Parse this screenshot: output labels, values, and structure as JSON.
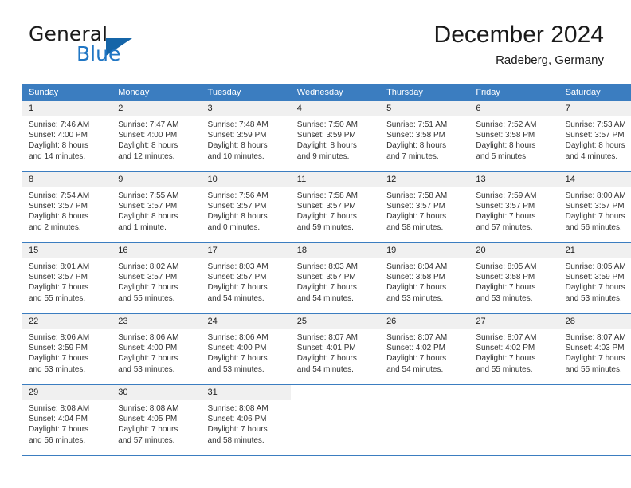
{
  "brand": {
    "name_top": "General",
    "name_bottom": "Blue",
    "accent_color": "#2076c4",
    "triangle_color": "#1565a8"
  },
  "header": {
    "title": "December 2024",
    "subtitle": "Radeberg, Germany"
  },
  "theme": {
    "header_blue": "#3b7dc0",
    "daynum_bg": "#f0f0f0",
    "text": "#222222"
  },
  "calendar": {
    "weekday_headers": [
      "Sunday",
      "Monday",
      "Tuesday",
      "Wednesday",
      "Thursday",
      "Friday",
      "Saturday"
    ],
    "weeks": [
      [
        {
          "day": "1",
          "sunrise": "Sunrise: 7:46 AM",
          "sunset": "Sunset: 4:00 PM",
          "daylight1": "Daylight: 8 hours",
          "daylight2": "and 14 minutes."
        },
        {
          "day": "2",
          "sunrise": "Sunrise: 7:47 AM",
          "sunset": "Sunset: 4:00 PM",
          "daylight1": "Daylight: 8 hours",
          "daylight2": "and 12 minutes."
        },
        {
          "day": "3",
          "sunrise": "Sunrise: 7:48 AM",
          "sunset": "Sunset: 3:59 PM",
          "daylight1": "Daylight: 8 hours",
          "daylight2": "and 10 minutes."
        },
        {
          "day": "4",
          "sunrise": "Sunrise: 7:50 AM",
          "sunset": "Sunset: 3:59 PM",
          "daylight1": "Daylight: 8 hours",
          "daylight2": "and 9 minutes."
        },
        {
          "day": "5",
          "sunrise": "Sunrise: 7:51 AM",
          "sunset": "Sunset: 3:58 PM",
          "daylight1": "Daylight: 8 hours",
          "daylight2": "and 7 minutes."
        },
        {
          "day": "6",
          "sunrise": "Sunrise: 7:52 AM",
          "sunset": "Sunset: 3:58 PM",
          "daylight1": "Daylight: 8 hours",
          "daylight2": "and 5 minutes."
        },
        {
          "day": "7",
          "sunrise": "Sunrise: 7:53 AM",
          "sunset": "Sunset: 3:57 PM",
          "daylight1": "Daylight: 8 hours",
          "daylight2": "and 4 minutes."
        }
      ],
      [
        {
          "day": "8",
          "sunrise": "Sunrise: 7:54 AM",
          "sunset": "Sunset: 3:57 PM",
          "daylight1": "Daylight: 8 hours",
          "daylight2": "and 2 minutes."
        },
        {
          "day": "9",
          "sunrise": "Sunrise: 7:55 AM",
          "sunset": "Sunset: 3:57 PM",
          "daylight1": "Daylight: 8 hours",
          "daylight2": "and 1 minute."
        },
        {
          "day": "10",
          "sunrise": "Sunrise: 7:56 AM",
          "sunset": "Sunset: 3:57 PM",
          "daylight1": "Daylight: 8 hours",
          "daylight2": "and 0 minutes."
        },
        {
          "day": "11",
          "sunrise": "Sunrise: 7:58 AM",
          "sunset": "Sunset: 3:57 PM",
          "daylight1": "Daylight: 7 hours",
          "daylight2": "and 59 minutes."
        },
        {
          "day": "12",
          "sunrise": "Sunrise: 7:58 AM",
          "sunset": "Sunset: 3:57 PM",
          "daylight1": "Daylight: 7 hours",
          "daylight2": "and 58 minutes."
        },
        {
          "day": "13",
          "sunrise": "Sunrise: 7:59 AM",
          "sunset": "Sunset: 3:57 PM",
          "daylight1": "Daylight: 7 hours",
          "daylight2": "and 57 minutes."
        },
        {
          "day": "14",
          "sunrise": "Sunrise: 8:00 AM",
          "sunset": "Sunset: 3:57 PM",
          "daylight1": "Daylight: 7 hours",
          "daylight2": "and 56 minutes."
        }
      ],
      [
        {
          "day": "15",
          "sunrise": "Sunrise: 8:01 AM",
          "sunset": "Sunset: 3:57 PM",
          "daylight1": "Daylight: 7 hours",
          "daylight2": "and 55 minutes."
        },
        {
          "day": "16",
          "sunrise": "Sunrise: 8:02 AM",
          "sunset": "Sunset: 3:57 PM",
          "daylight1": "Daylight: 7 hours",
          "daylight2": "and 55 minutes."
        },
        {
          "day": "17",
          "sunrise": "Sunrise: 8:03 AM",
          "sunset": "Sunset: 3:57 PM",
          "daylight1": "Daylight: 7 hours",
          "daylight2": "and 54 minutes."
        },
        {
          "day": "18",
          "sunrise": "Sunrise: 8:03 AM",
          "sunset": "Sunset: 3:57 PM",
          "daylight1": "Daylight: 7 hours",
          "daylight2": "and 54 minutes."
        },
        {
          "day": "19",
          "sunrise": "Sunrise: 8:04 AM",
          "sunset": "Sunset: 3:58 PM",
          "daylight1": "Daylight: 7 hours",
          "daylight2": "and 53 minutes."
        },
        {
          "day": "20",
          "sunrise": "Sunrise: 8:05 AM",
          "sunset": "Sunset: 3:58 PM",
          "daylight1": "Daylight: 7 hours",
          "daylight2": "and 53 minutes."
        },
        {
          "day": "21",
          "sunrise": "Sunrise: 8:05 AM",
          "sunset": "Sunset: 3:59 PM",
          "daylight1": "Daylight: 7 hours",
          "daylight2": "and 53 minutes."
        }
      ],
      [
        {
          "day": "22",
          "sunrise": "Sunrise: 8:06 AM",
          "sunset": "Sunset: 3:59 PM",
          "daylight1": "Daylight: 7 hours",
          "daylight2": "and 53 minutes."
        },
        {
          "day": "23",
          "sunrise": "Sunrise: 8:06 AM",
          "sunset": "Sunset: 4:00 PM",
          "daylight1": "Daylight: 7 hours",
          "daylight2": "and 53 minutes."
        },
        {
          "day": "24",
          "sunrise": "Sunrise: 8:06 AM",
          "sunset": "Sunset: 4:00 PM",
          "daylight1": "Daylight: 7 hours",
          "daylight2": "and 53 minutes."
        },
        {
          "day": "25",
          "sunrise": "Sunrise: 8:07 AM",
          "sunset": "Sunset: 4:01 PM",
          "daylight1": "Daylight: 7 hours",
          "daylight2": "and 54 minutes."
        },
        {
          "day": "26",
          "sunrise": "Sunrise: 8:07 AM",
          "sunset": "Sunset: 4:02 PM",
          "daylight1": "Daylight: 7 hours",
          "daylight2": "and 54 minutes."
        },
        {
          "day": "27",
          "sunrise": "Sunrise: 8:07 AM",
          "sunset": "Sunset: 4:02 PM",
          "daylight1": "Daylight: 7 hours",
          "daylight2": "and 55 minutes."
        },
        {
          "day": "28",
          "sunrise": "Sunrise: 8:07 AM",
          "sunset": "Sunset: 4:03 PM",
          "daylight1": "Daylight: 7 hours",
          "daylight2": "and 55 minutes."
        }
      ],
      [
        {
          "day": "29",
          "sunrise": "Sunrise: 8:08 AM",
          "sunset": "Sunset: 4:04 PM",
          "daylight1": "Daylight: 7 hours",
          "daylight2": "and 56 minutes."
        },
        {
          "day": "30",
          "sunrise": "Sunrise: 8:08 AM",
          "sunset": "Sunset: 4:05 PM",
          "daylight1": "Daylight: 7 hours",
          "daylight2": "and 57 minutes."
        },
        {
          "day": "31",
          "sunrise": "Sunrise: 8:08 AM",
          "sunset": "Sunset: 4:06 PM",
          "daylight1": "Daylight: 7 hours",
          "daylight2": "and 58 minutes."
        },
        {
          "day": "",
          "sunrise": "",
          "sunset": "",
          "daylight1": "",
          "daylight2": ""
        },
        {
          "day": "",
          "sunrise": "",
          "sunset": "",
          "daylight1": "",
          "daylight2": ""
        },
        {
          "day": "",
          "sunrise": "",
          "sunset": "",
          "daylight1": "",
          "daylight2": ""
        },
        {
          "day": "",
          "sunrise": "",
          "sunset": "",
          "daylight1": "",
          "daylight2": ""
        }
      ]
    ]
  }
}
